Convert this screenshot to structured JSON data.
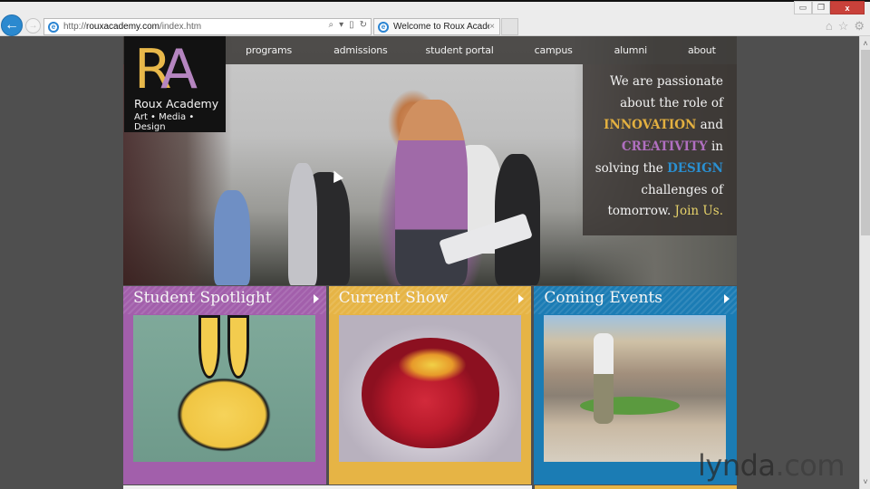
{
  "browser": {
    "url_prefix": "http://",
    "url_host": "rouxacademy.com",
    "url_path": "/index.htm",
    "tab_title": "Welcome to Roux Academy",
    "tab_close": "×",
    "back_icon": "←",
    "forward_icon": "→",
    "search_icon": "⌕",
    "dropdown_icon": "▾",
    "compat_icon": "▯",
    "refresh_icon": "↻",
    "home_icon": "⌂",
    "favorites_icon": "☆",
    "settings_icon": "⚙",
    "minimize_icon": "▭",
    "restore_icon": "❐",
    "close_icon": "x",
    "scroll_up_icon": "˄",
    "scroll_down_icon": "˅"
  },
  "site": {
    "logo": {
      "letter_r": "R",
      "letter_a": "A",
      "name": "Roux Academy",
      "tagline": "Art • Media • Design"
    },
    "nav": [
      {
        "label": "programs"
      },
      {
        "label": "admissions"
      },
      {
        "label": "student portal"
      },
      {
        "label": "campus"
      },
      {
        "label": "alumni"
      },
      {
        "label": "about"
      }
    ],
    "hero_message": {
      "line1": "We are passionate",
      "line2": "about the role of",
      "innovation": "INNOVATION",
      "and": " and",
      "creativity": "CREATIVITY",
      "in": " in",
      "solving": "solving the ",
      "design": "DESIGN",
      "line6": "challenges of",
      "tomorrow": "tomorrow. ",
      "join": "Join Us."
    },
    "features": [
      {
        "title": "Student Spotlight",
        "color": "#a25fab",
        "image": "graffiti bunny"
      },
      {
        "title": "Current Show",
        "color": "#e6b445",
        "image": "red glass stone"
      },
      {
        "title": "Coming Events",
        "color": "#1b7cb4",
        "image": "outdoor art event"
      }
    ],
    "colors": {
      "innovation": "#e3b040",
      "creativity": "#b06fc0",
      "design": "#2a8fd0",
      "join": "#e6d26a"
    }
  },
  "watermark": {
    "brand": "lynda",
    "suffix": ".com"
  }
}
